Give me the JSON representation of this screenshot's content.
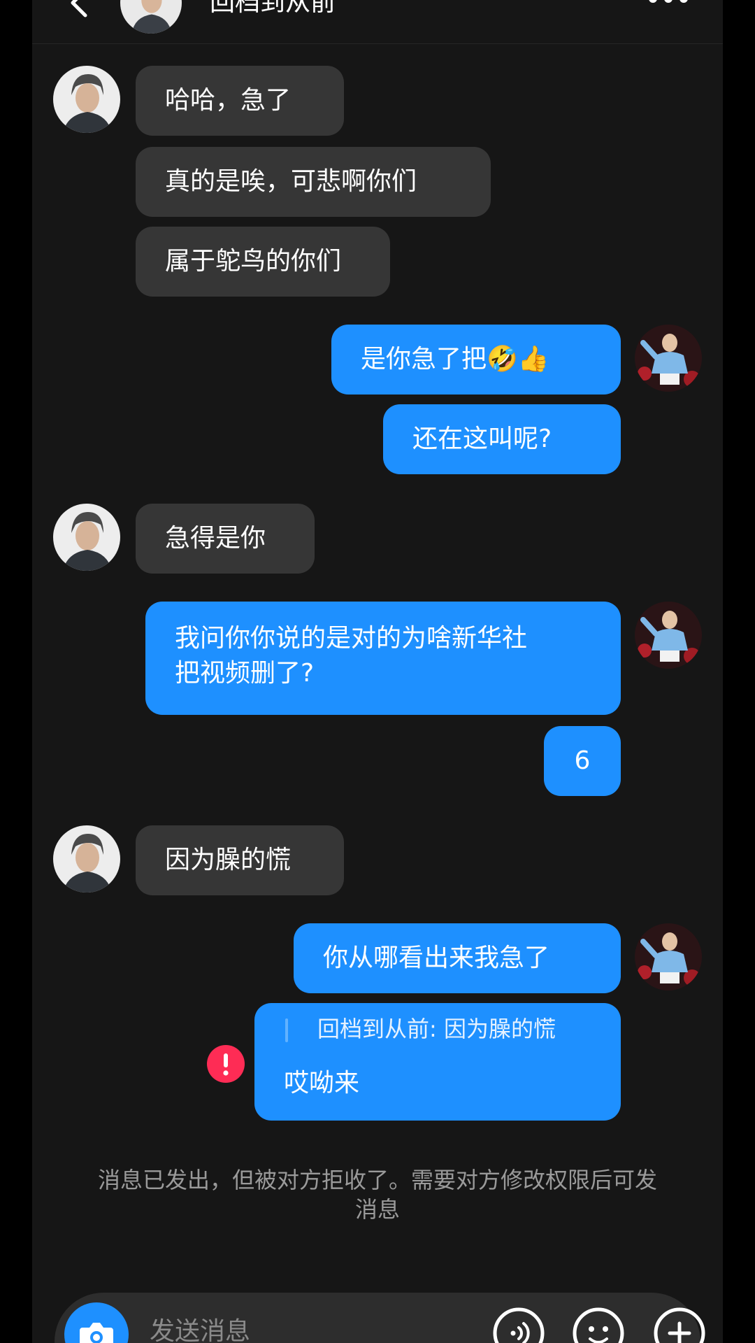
{
  "header": {
    "title": "回档到从前"
  },
  "messages": {
    "m1": "哈哈，急了",
    "m2": "真的是唉，可悲啊你们",
    "m3": "属于鸵鸟的你们",
    "m4": "是你急了把🤣👍",
    "m5": "还在这叫呢?",
    "m6": "急得是你",
    "m7_line1": "我问你你说的是对的为啥新华社",
    "m7_line2": "把视频删了?",
    "m8": "6",
    "m9": "因为臊的慌",
    "m10": "你从哪看出来我急了",
    "m11_quote": "回档到从前: 因为臊的慌",
    "m11_text": "哎呦来"
  },
  "notice": {
    "line1": "消息已发出，但被对方拒收了。需要对方修改权限后可发",
    "line2": "消息"
  },
  "composer": {
    "placeholder": "发送消息"
  },
  "colors": {
    "background": "#161616",
    "incoming_bubble": "#363636",
    "outgoing_bubble": "#1e90ff",
    "error": "#fe2c55"
  }
}
